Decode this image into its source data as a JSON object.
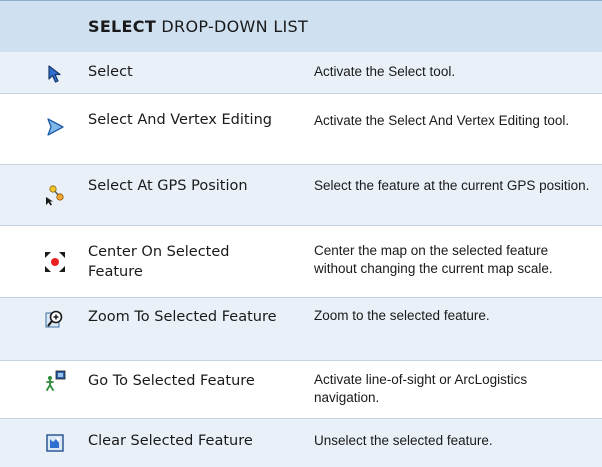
{
  "header": {
    "title_bold": "SELECT",
    "title_rest": " DROP-DOWN LIST"
  },
  "rows": [
    {
      "icon": "select-arrow-icon",
      "name": "Select",
      "description": "Activate the Select tool."
    },
    {
      "icon": "vertex-arrow-icon",
      "name": "Select And Vertex Editing",
      "description": "Activate the Select And Vertex Editing tool."
    },
    {
      "icon": "gps-select-icon",
      "name": "Select At GPS Position",
      "description": "Select the feature at the current GPS position."
    },
    {
      "icon": "center-target-icon",
      "name": "Center On Selected Feature",
      "description": "Center the map on the selected feature without changing the current map scale."
    },
    {
      "icon": "zoom-in-icon",
      "name": "Zoom To Selected Feature",
      "description": "Zoom to the selected feature."
    },
    {
      "icon": "walking-person-icon",
      "name": "Go To Selected Feature",
      "description": "Activate line-of-sight or ArcLogistics navigation."
    },
    {
      "icon": "clear-selection-icon",
      "name": "Clear Selected Feature",
      "description": "Unselect the selected feature."
    }
  ]
}
